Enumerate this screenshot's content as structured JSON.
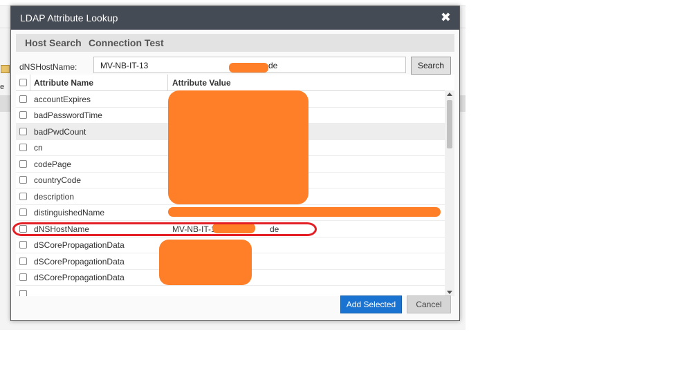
{
  "background": {
    "fragment_text": "e"
  },
  "dialog": {
    "title": "LDAP Attribute Lookup",
    "close_glyph": "✖",
    "tabs": [
      {
        "label": "Host Search"
      },
      {
        "label": "Connection Test"
      }
    ]
  },
  "search": {
    "label": "dNSHostName:",
    "value_prefix": "MV-NB-IT-13",
    "value_suffix": "de",
    "button_label": "Search"
  },
  "grid": {
    "columns": [
      "Attribute Name",
      "Attribute Value"
    ],
    "rows": [
      {
        "name": "accountExpires",
        "value": ""
      },
      {
        "name": "badPasswordTime",
        "value": ""
      },
      {
        "name": "badPwdCount",
        "value": ""
      },
      {
        "name": "cn",
        "value": ""
      },
      {
        "name": "codePage",
        "value": ""
      },
      {
        "name": "countryCode",
        "value": ""
      },
      {
        "name": "description",
        "value": ""
      },
      {
        "name": "distinguishedName",
        "value": ""
      },
      {
        "name": "dNSHostName",
        "value_prefix": "MV-NB-IT-13",
        "value_suffix": "de"
      },
      {
        "name": "dSCorePropagationData",
        "value": ""
      },
      {
        "name": "dSCorePropagationData",
        "value": ""
      },
      {
        "name": "dSCorePropagationData",
        "value": ""
      }
    ]
  },
  "footer": {
    "add_label": "Add Selected",
    "cancel_label": "Cancel"
  },
  "colors": {
    "header_bg": "#454b54",
    "primary_button": "#1a73d1",
    "redaction": "#fe7f27",
    "annotation": "#e31e24"
  }
}
